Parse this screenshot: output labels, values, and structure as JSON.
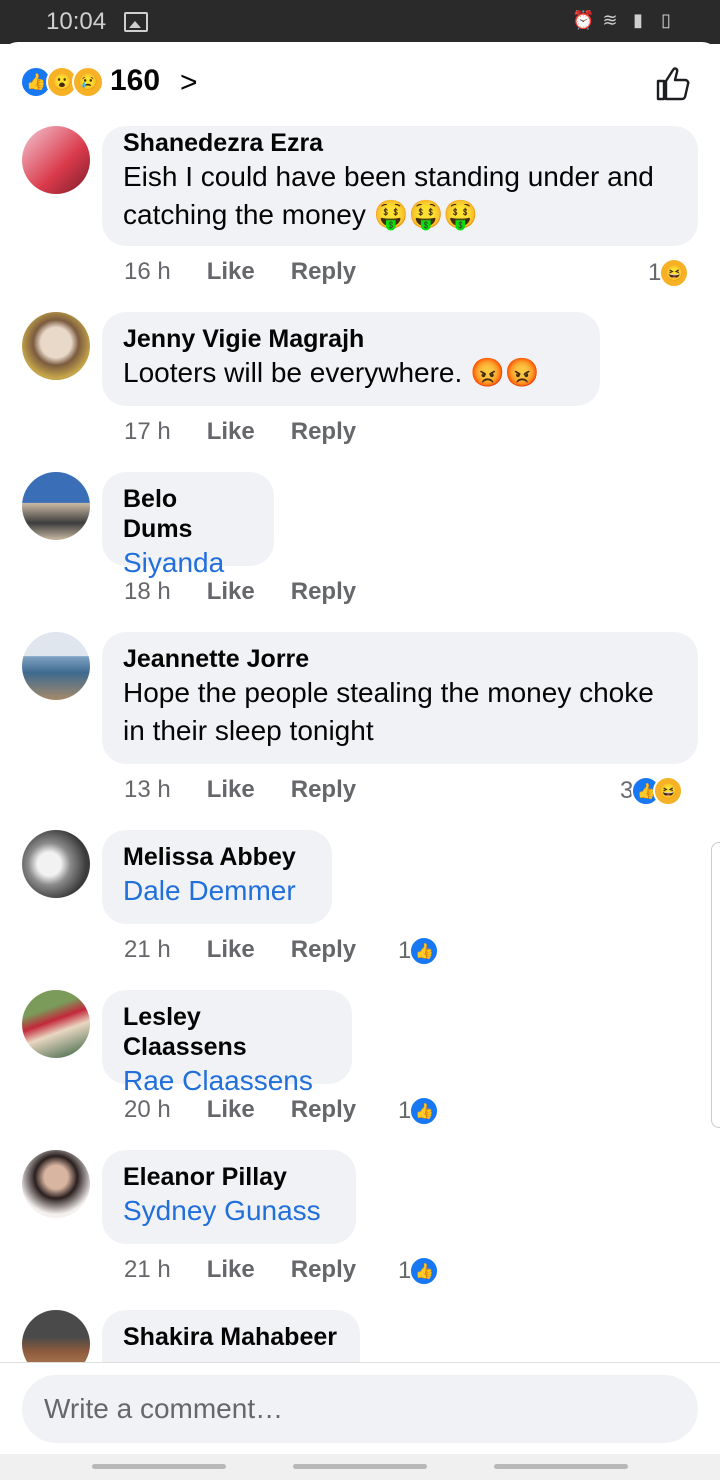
{
  "status_bar": {
    "time": "10:04"
  },
  "header": {
    "reaction_count": "160",
    "reactions": [
      "like",
      "wow",
      "sad"
    ]
  },
  "comments": [
    {
      "author": "Shanedezra Ezra",
      "text": "Eish I could have been standing under and catching the money 🤑🤑🤑",
      "time": "16 h",
      "like": "Like",
      "reply": "Reply",
      "reaction_count": "1",
      "reactions": [
        "haha"
      ]
    },
    {
      "author": "Jenny Vigie Magrajh",
      "text": "Looters will be everywhere. 😡😡",
      "time": "17 h",
      "like": "Like",
      "reply": "Reply"
    },
    {
      "author": "Belo Dums",
      "text": "Siyanda",
      "time": "18 h",
      "like": "Like",
      "reply": "Reply"
    },
    {
      "author": "Jeannette Jorre",
      "text": "Hope the people stealing the money choke in their sleep tonight",
      "time": "13 h",
      "like": "Like",
      "reply": "Reply",
      "reaction_count": "3",
      "reactions": [
        "like",
        "haha"
      ]
    },
    {
      "author": "Melissa Abbey",
      "text": "Dale Demmer",
      "time": "21 h",
      "like": "Like",
      "reply": "Reply",
      "reaction_count": "1",
      "reactions": [
        "like"
      ]
    },
    {
      "author": "Lesley Claassens",
      "text": "Rae Claassens",
      "time": "20 h",
      "like": "Like",
      "reply": "Reply",
      "reaction_count": "1",
      "reactions": [
        "like"
      ]
    },
    {
      "author": "Eleanor Pillay",
      "text": "Sydney Gunass",
      "time": "21 h",
      "like": "Like",
      "reply": "Reply",
      "reaction_count": "1",
      "reactions": [
        "like"
      ]
    },
    {
      "author": "Shakira Mahabeer"
    }
  ],
  "composer": {
    "placeholder": "Write a comment…"
  },
  "colors": {
    "accent": "#1877f2",
    "tag": "#216fdb",
    "bubble": "#f0f2f5",
    "meta": "#65676b"
  }
}
